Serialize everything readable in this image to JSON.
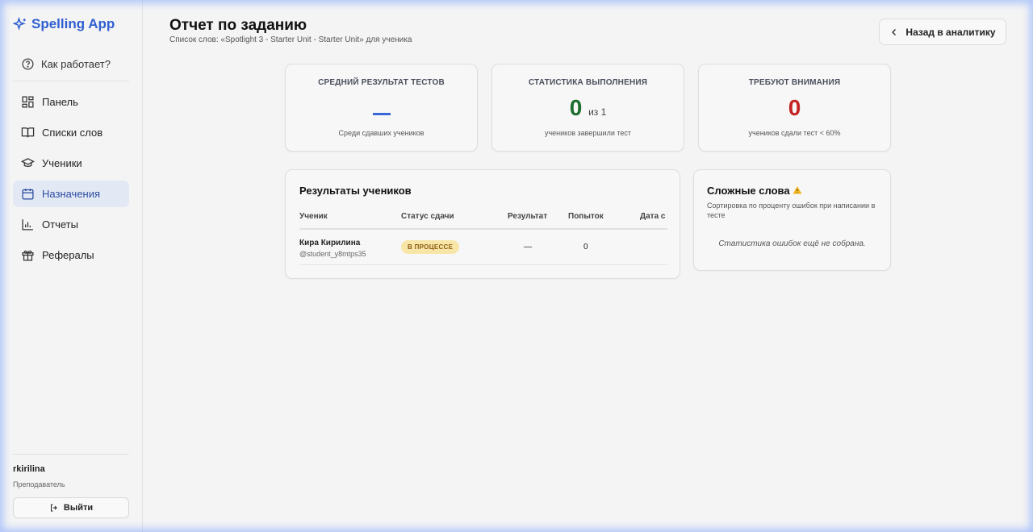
{
  "app": {
    "name": "Spelling App",
    "accent": "#2f5fd1"
  },
  "sidebar": {
    "how_it_works": "Как работает?",
    "items": [
      {
        "label": "Панель",
        "icon": "dashboard-icon"
      },
      {
        "label": "Списки слов",
        "icon": "book-icon"
      },
      {
        "label": "Ученики",
        "icon": "graduation-cap-icon"
      },
      {
        "label": "Назначения",
        "icon": "calendar-icon",
        "active": true
      },
      {
        "label": "Отчеты",
        "icon": "bar-chart-icon"
      },
      {
        "label": "Рефералы",
        "icon": "gift-icon"
      }
    ],
    "user": {
      "name": "rkirilina",
      "role": "Преподаватель"
    },
    "logout_label": "Выйти"
  },
  "header": {
    "title": "Отчет по заданию",
    "subtitle": "Список слов: «Spotlight 3 - Starter Unit - Starter Unit» для ученика",
    "back_label": "Назад в аналитику"
  },
  "stats": {
    "avg": {
      "label": "СРЕДНИЙ РЕЗУЛЬТАТ ТЕСТОВ",
      "value": "—",
      "caption": "Среди сдавших учеников"
    },
    "completion": {
      "label": "СТАТИСТИКА ВЫПОЛНЕНИЯ",
      "value": "0",
      "of": "из 1",
      "caption": "учеников завершили тест"
    },
    "attention": {
      "label": "ТРЕБУЮТ ВНИМАНИЯ",
      "value": "0",
      "caption": "учеников сдали тест < 60%"
    }
  },
  "results": {
    "title": "Результаты учеников",
    "columns": [
      "Ученик",
      "Статус сдачи",
      "Результат",
      "Попыток",
      "Дата с"
    ],
    "rows": [
      {
        "name": "Кира Кирилина",
        "username": "@student_y8mtps35",
        "status": "В ПРОЦЕССЕ",
        "result": "—",
        "attempts": "0"
      }
    ]
  },
  "hard_words": {
    "title": "Сложные слова",
    "icon": "warning-icon",
    "description": "Сортировка по проценту ошибок при написании в тесте",
    "empty": "Статистика ошибок ещё не собрана."
  }
}
